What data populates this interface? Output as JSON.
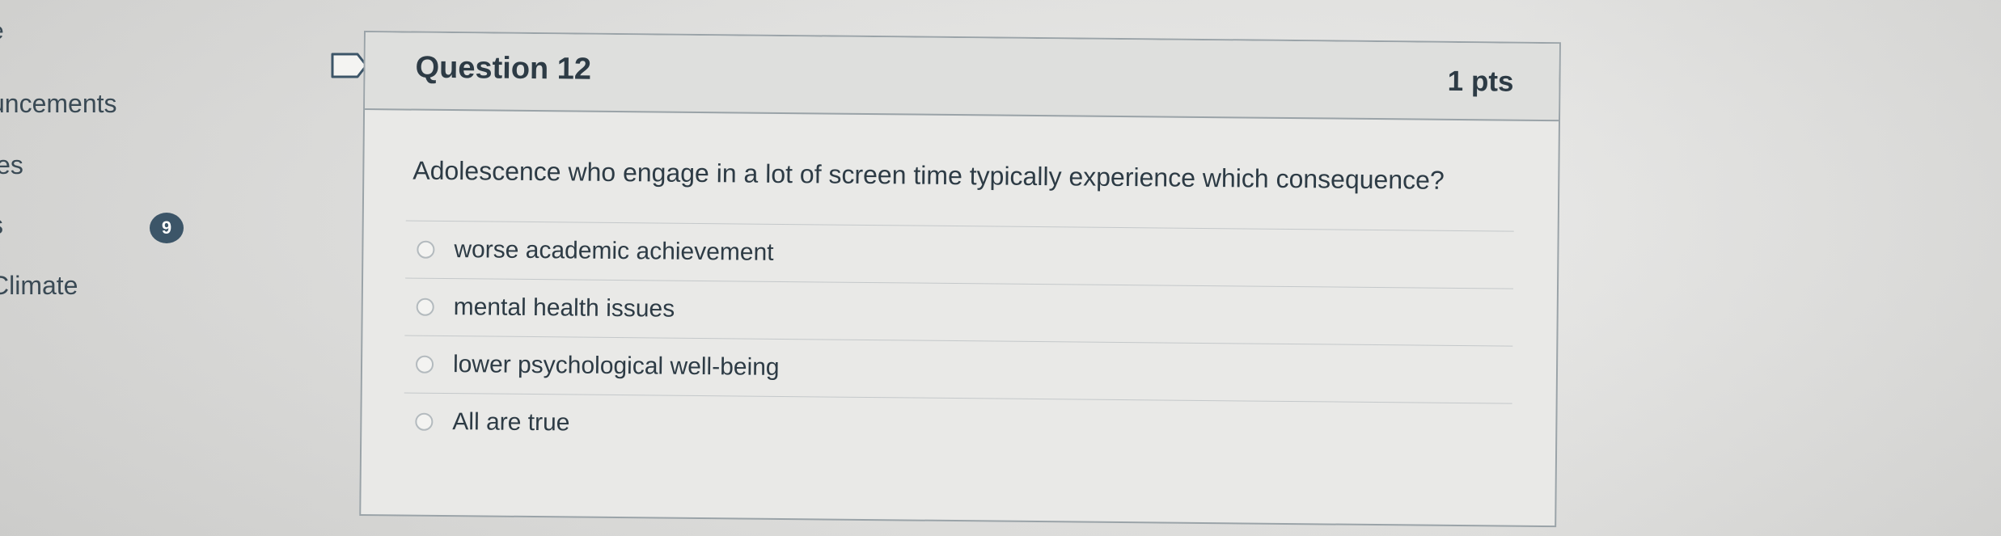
{
  "course_nav": {
    "items": [
      {
        "label": "e"
      },
      {
        "label": "uncements"
      },
      {
        "label": "les"
      },
      {
        "label": "s"
      },
      {
        "label": "Climate"
      }
    ],
    "badge_count": "9"
  },
  "question": {
    "title": "Question 12",
    "points": "1 pts",
    "text": "Adolescence who engage in a lot of screen time typically experience which consequence?",
    "answers": [
      {
        "label": "worse academic achievement",
        "selected": false
      },
      {
        "label": "mental health issues",
        "selected": false
      },
      {
        "label": "lower psychological well-being",
        "selected": false
      },
      {
        "label": "All are true",
        "selected": false
      }
    ]
  },
  "icons": {
    "flag": "bookmark-flag-icon",
    "radio": "radio-button-icon"
  }
}
